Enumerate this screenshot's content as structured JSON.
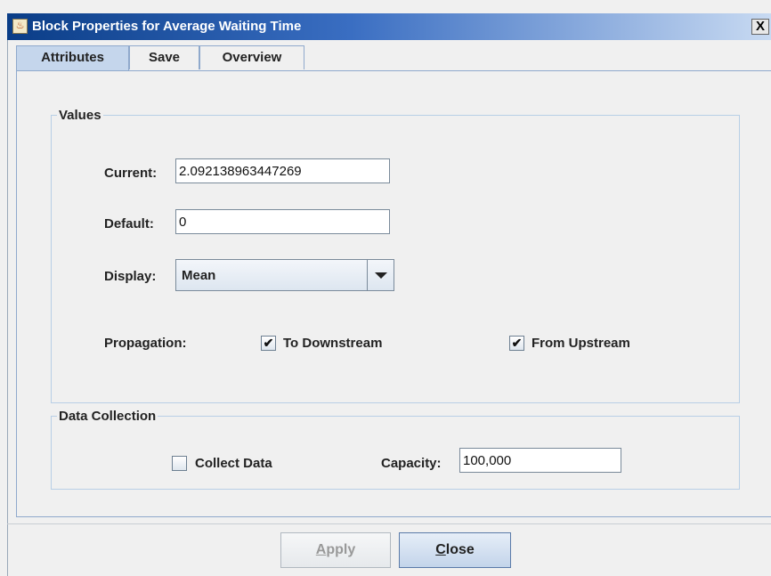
{
  "window": {
    "title": "Block Properties for Average Waiting Time",
    "close_glyph": "X",
    "app_icon_glyph": "♨"
  },
  "tabs": [
    {
      "label": "Attributes",
      "active": true
    },
    {
      "label": "Save",
      "active": false
    },
    {
      "label": "Overview",
      "active": false
    }
  ],
  "values_group": {
    "legend": "Values",
    "current_label": "Current:",
    "current_value": "2.092138963447269",
    "default_label": "Default:",
    "default_value": "0",
    "display_label": "Display:",
    "display_value": "Mean",
    "propagation_label": "Propagation:",
    "to_downstream_label": "To Downstream",
    "to_downstream_checked": true,
    "from_upstream_label": "From Upstream",
    "from_upstream_checked": true,
    "check_glyph": "✔"
  },
  "data_collection": {
    "legend": "Data Collection",
    "collect_label": "Collect Data",
    "collect_checked": false,
    "capacity_label": "Capacity:",
    "capacity_value": "100,000"
  },
  "buttons": {
    "apply_first": "A",
    "apply_rest": "pply",
    "apply_enabled": false,
    "close_first": "C",
    "close_rest": "lose"
  }
}
